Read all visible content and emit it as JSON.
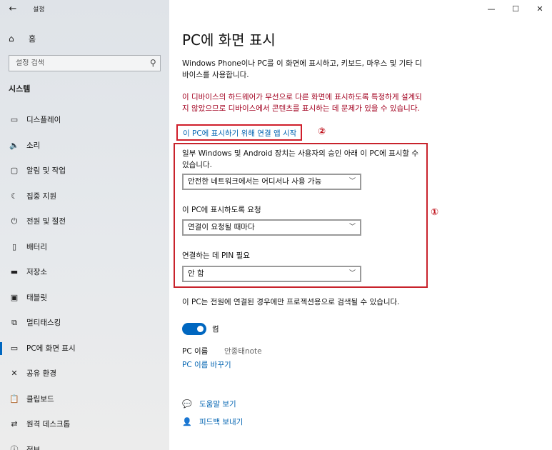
{
  "window": {
    "app_title": "설정",
    "controls": [
      "—",
      "☐",
      "✕"
    ]
  },
  "sidebar": {
    "home": "홈",
    "search_placeholder": "설정 검색",
    "section": "시스템",
    "items": [
      {
        "icon": "display-icon",
        "glyph": "▭",
        "label": "디스플레이"
      },
      {
        "icon": "sound-icon",
        "glyph": "🔈",
        "label": "소리"
      },
      {
        "icon": "notification-icon",
        "glyph": "▢",
        "label": "알림 및 작업"
      },
      {
        "icon": "focus-assist-icon",
        "glyph": "☾",
        "label": "집중 지원"
      },
      {
        "icon": "power-icon",
        "glyph": "⏻",
        "label": "전원 및 절전"
      },
      {
        "icon": "battery-icon",
        "glyph": "▯",
        "label": "배터리"
      },
      {
        "icon": "storage-icon",
        "glyph": "▬",
        "label": "저장소"
      },
      {
        "icon": "tablet-icon",
        "glyph": "▣",
        "label": "태블릿"
      },
      {
        "icon": "multitasking-icon",
        "glyph": "⧉",
        "label": "멀티태스킹"
      },
      {
        "icon": "project-icon",
        "glyph": "▭",
        "label": "PC에 화면 표시",
        "active": true
      },
      {
        "icon": "shared-experiences-icon",
        "glyph": "✕",
        "label": "공유 환경"
      },
      {
        "icon": "clipboard-icon",
        "glyph": "📋",
        "label": "클립보드"
      },
      {
        "icon": "remote-desktop-icon",
        "glyph": "⇄",
        "label": "원격 데스크톱"
      },
      {
        "icon": "about-icon",
        "glyph": "ⓘ",
        "label": "정보"
      }
    ]
  },
  "main": {
    "title": "PC에 화면 표시",
    "description": "Windows Phone이나 PC를 이 화면에 표시하고, 키보드, 마우스 및 기타 디바이스를 사용합니다.",
    "warning": "이 디바이스의 하드웨어가 무선으로 다른 화면에 표시하도록 특정하게 설계되지 않았으므로 디바이스에서 콘텐츠를 표시하는 데 문제가 있을 수 있습니다.",
    "launch_link": "이 PC에 표시하기 위해 연결 앱 시작",
    "badge_launch": "②",
    "badge_box": "①",
    "option1_label": "일부 Windows 및 Android 장치는 사용자의 승인 아래 이 PC에 표시할 수 있습니다.",
    "option1_value": "안전한 네트워크에서는 어디서나 사용 가능",
    "option2_label": "이 PC에 표시하도록 요청",
    "option2_value": "연결이 요청될 때마다",
    "option3_label": "연결하는 데 PIN 필요",
    "option3_value": "안 함",
    "power_text": "이 PC는 전원에 연결된 경우에만 프로젝션용으로 검색될 수 있습니다.",
    "toggle_label": "켬",
    "toggle_on": true,
    "pc_name_label": "PC 이름",
    "pc_name_value": "안종태note",
    "rename_link": "PC 이름 바꾸기",
    "help_link": "도움말 보기",
    "feedback_link": "피드백 보내기"
  }
}
